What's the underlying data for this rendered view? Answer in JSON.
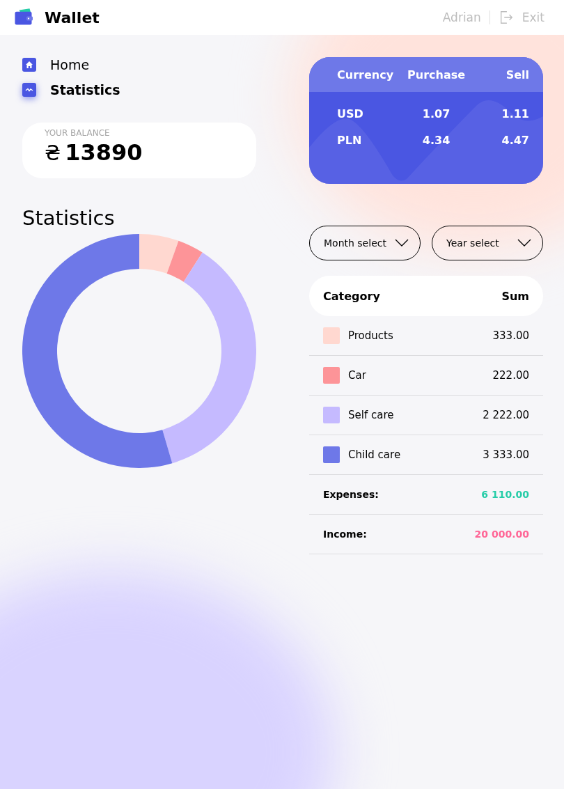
{
  "header": {
    "logo": "Wallet",
    "user": "Adrian",
    "exit": "Exit"
  },
  "nav": [
    {
      "label": "Home",
      "selected": false,
      "kind": "home"
    },
    {
      "label": "Statistics",
      "selected": true,
      "kind": "stats"
    }
  ],
  "balance": {
    "label": "YOUR BALANCE",
    "currency": "₴",
    "amount": "13890"
  },
  "currency_table": {
    "columns": [
      "Currency",
      "Purchase",
      "Sell"
    ],
    "rows": [
      [
        "USD",
        "1.07",
        "1.11"
      ],
      [
        "PLN",
        "4.34",
        "4.47"
      ]
    ]
  },
  "statistics": {
    "title": "Statistics",
    "chart_data": {
      "type": "donut",
      "values": [
        5.45,
        3.63,
        36.37,
        54.55
      ]
    }
  },
  "filters": [
    {
      "label": "Month select"
    },
    {
      "label": "Year select"
    }
  ],
  "table": {
    "columns": [
      "Category",
      "Sum"
    ],
    "rows": [
      {
        "category": "Products",
        "sum": "333.00",
        "color": "#ffd8d0"
      },
      {
        "category": "Car",
        "sum": "222.00",
        "color": "#fd9498"
      },
      {
        "category": "Self care",
        "sum": "2 222.00",
        "color": "#c5baff"
      },
      {
        "category": "Child care",
        "sum": "3 333.00",
        "color": "#6e78e8"
      }
    ],
    "totals": [
      {
        "label": "Expenses:",
        "value": "6 110.00",
        "color": "#24cca7"
      },
      {
        "label": "Income:",
        "value": "20 000.00",
        "color": "#ff6596"
      }
    ]
  }
}
